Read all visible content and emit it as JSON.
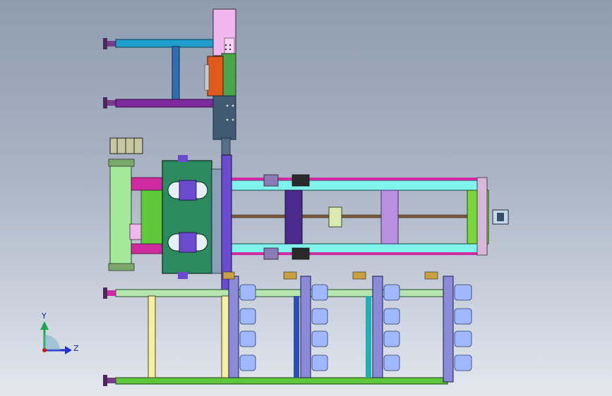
{
  "viewport": {
    "background_top": "#8f9cb0",
    "background_bottom": "#e4e8ee"
  },
  "triad": {
    "y_label": "Y",
    "z_label": "Z",
    "y_color": "#1aa84a",
    "z_color": "#2233cc",
    "origin_color": "#cc1a1a"
  },
  "colors": {
    "cyan_rail": "#1f9fc9",
    "blue_post": "#2f6fb0",
    "purple_rail": "#7a2a9a",
    "pink_block": "#f2b6ee",
    "orange_block": "#e05a1e",
    "green_column": "#4aa64a",
    "slate_block": "#3f5a72",
    "dark_green_carriage": "#2b8a5e",
    "light_green_frame": "#a6e89a",
    "aqua_rail": "#7ff2ec",
    "violet_post": "#6a4bd0",
    "dark_violet": "#4a2a8a",
    "lavender": "#b890e0",
    "lime_plate": "#76d63a",
    "magenta": "#d02aa0",
    "spool_blue": "#9fb8ff",
    "pale_green_beam": "#b6e6b0",
    "pale_yellow": "#f4f0a0",
    "green_beam": "#5ec83a",
    "periwinkle": "#8a8ad8"
  }
}
